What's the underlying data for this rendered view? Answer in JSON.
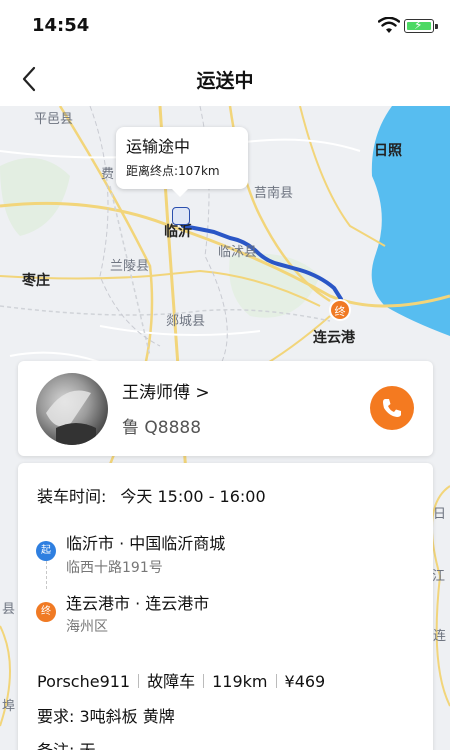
{
  "status_bar": {
    "time": "14:54",
    "wifi_icon": "wifi-icon",
    "battery_icon": "battery-charging-icon"
  },
  "nav": {
    "title": "运送中",
    "back_icon": "chevron-left-icon"
  },
  "map": {
    "labels": {
      "pingyi": "平邑县",
      "feixian": "费",
      "rizhao": "日照",
      "junan": "莒南县",
      "linyi": "临沂",
      "linshu": "临沭县",
      "lanling": "兰陵县",
      "zaozhuang": "枣庄",
      "tancheng": "郯城县",
      "lianyungang": "连云港",
      "right_ri": "日",
      "right_jiang": "江",
      "right_lian": "连",
      "left_xian": "县",
      "left_fu": "埠"
    },
    "bubble": {
      "title": "运输途中",
      "distance": "距离终点:107km"
    },
    "end_marker": "终",
    "colors": {
      "route": "#2a56c6",
      "sea": "#57bdf0",
      "marker": "#f07a24"
    }
  },
  "driver": {
    "name": "王涛师傅 >",
    "plate": "鲁 Q8888",
    "call_icon": "phone-icon"
  },
  "order": {
    "load_time_label": "装车时间:",
    "load_time_value": "今天 15:00 - 16:00",
    "start_pin": "起",
    "start_title": "临沂市 · 中国临沂商城",
    "start_sub": "临西十路191号",
    "end_pin": "终",
    "end_title": "连云港市 · 连云港市",
    "end_sub": "海州区",
    "vehicle_model": "Porsche911",
    "vehicle_type": "故障车",
    "distance": "119km",
    "price": "¥469",
    "requirement": "要求: 3吨斜板 黄牌",
    "note": "备注: 无"
  }
}
